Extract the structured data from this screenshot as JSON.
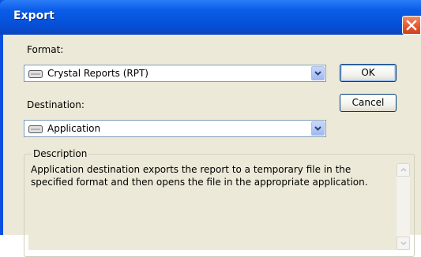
{
  "dialog": {
    "title": "Export",
    "ok_label": "OK",
    "cancel_label": "Cancel"
  },
  "format": {
    "label": "Format:",
    "selected": "Crystal Reports (RPT)"
  },
  "destination": {
    "label": "Destination:",
    "selected": "Application"
  },
  "description": {
    "legend": "Description",
    "text": "Application destination exports the report to a temporary file in the specified format and then opens the file in the appropriate application."
  },
  "icons": {
    "close": "close-icon",
    "dropdown": "chevron-down-icon",
    "item": "drive-icon",
    "scroll_up": "scroll-up-icon",
    "scroll_down": "scroll-down-icon"
  },
  "colors": {
    "titlebar": "#0a5ce8",
    "close_button": "#e35a30",
    "dialog_background": "#ece9d8",
    "field_border": "#7f9db9"
  }
}
